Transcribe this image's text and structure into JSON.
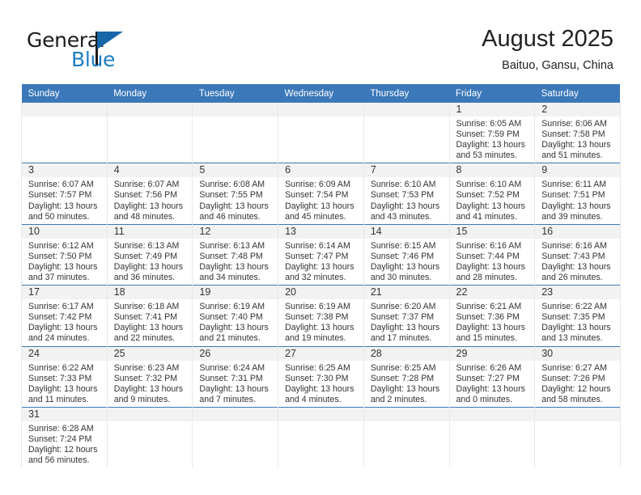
{
  "brand": {
    "name_part1": "General",
    "name_part2": "Blue"
  },
  "header": {
    "title": "August 2025",
    "location": "Baituo, Gansu, China"
  },
  "colors": {
    "header_blue": "#3b78b9",
    "brand_blue": "#1d7ec4",
    "daynum_band": "#f2f2f2",
    "text": "#333333"
  },
  "weekday_headers": [
    "Sunday",
    "Monday",
    "Tuesday",
    "Wednesday",
    "Thursday",
    "Friday",
    "Saturday"
  ],
  "weeks": [
    [
      {
        "day": "",
        "sunrise": "",
        "sunset": "",
        "daylight1": "",
        "daylight2": ""
      },
      {
        "day": "",
        "sunrise": "",
        "sunset": "",
        "daylight1": "",
        "daylight2": ""
      },
      {
        "day": "",
        "sunrise": "",
        "sunset": "",
        "daylight1": "",
        "daylight2": ""
      },
      {
        "day": "",
        "sunrise": "",
        "sunset": "",
        "daylight1": "",
        "daylight2": ""
      },
      {
        "day": "",
        "sunrise": "",
        "sunset": "",
        "daylight1": "",
        "daylight2": ""
      },
      {
        "day": "1",
        "sunrise": "Sunrise: 6:05 AM",
        "sunset": "Sunset: 7:59 PM",
        "daylight1": "Daylight: 13 hours",
        "daylight2": "and 53 minutes."
      },
      {
        "day": "2",
        "sunrise": "Sunrise: 6:06 AM",
        "sunset": "Sunset: 7:58 PM",
        "daylight1": "Daylight: 13 hours",
        "daylight2": "and 51 minutes."
      }
    ],
    [
      {
        "day": "3",
        "sunrise": "Sunrise: 6:07 AM",
        "sunset": "Sunset: 7:57 PM",
        "daylight1": "Daylight: 13 hours",
        "daylight2": "and 50 minutes."
      },
      {
        "day": "4",
        "sunrise": "Sunrise: 6:07 AM",
        "sunset": "Sunset: 7:56 PM",
        "daylight1": "Daylight: 13 hours",
        "daylight2": "and 48 minutes."
      },
      {
        "day": "5",
        "sunrise": "Sunrise: 6:08 AM",
        "sunset": "Sunset: 7:55 PM",
        "daylight1": "Daylight: 13 hours",
        "daylight2": "and 46 minutes."
      },
      {
        "day": "6",
        "sunrise": "Sunrise: 6:09 AM",
        "sunset": "Sunset: 7:54 PM",
        "daylight1": "Daylight: 13 hours",
        "daylight2": "and 45 minutes."
      },
      {
        "day": "7",
        "sunrise": "Sunrise: 6:10 AM",
        "sunset": "Sunset: 7:53 PM",
        "daylight1": "Daylight: 13 hours",
        "daylight2": "and 43 minutes."
      },
      {
        "day": "8",
        "sunrise": "Sunrise: 6:10 AM",
        "sunset": "Sunset: 7:52 PM",
        "daylight1": "Daylight: 13 hours",
        "daylight2": "and 41 minutes."
      },
      {
        "day": "9",
        "sunrise": "Sunrise: 6:11 AM",
        "sunset": "Sunset: 7:51 PM",
        "daylight1": "Daylight: 13 hours",
        "daylight2": "and 39 minutes."
      }
    ],
    [
      {
        "day": "10",
        "sunrise": "Sunrise: 6:12 AM",
        "sunset": "Sunset: 7:50 PM",
        "daylight1": "Daylight: 13 hours",
        "daylight2": "and 37 minutes."
      },
      {
        "day": "11",
        "sunrise": "Sunrise: 6:13 AM",
        "sunset": "Sunset: 7:49 PM",
        "daylight1": "Daylight: 13 hours",
        "daylight2": "and 36 minutes."
      },
      {
        "day": "12",
        "sunrise": "Sunrise: 6:13 AM",
        "sunset": "Sunset: 7:48 PM",
        "daylight1": "Daylight: 13 hours",
        "daylight2": "and 34 minutes."
      },
      {
        "day": "13",
        "sunrise": "Sunrise: 6:14 AM",
        "sunset": "Sunset: 7:47 PM",
        "daylight1": "Daylight: 13 hours",
        "daylight2": "and 32 minutes."
      },
      {
        "day": "14",
        "sunrise": "Sunrise: 6:15 AM",
        "sunset": "Sunset: 7:46 PM",
        "daylight1": "Daylight: 13 hours",
        "daylight2": "and 30 minutes."
      },
      {
        "day": "15",
        "sunrise": "Sunrise: 6:16 AM",
        "sunset": "Sunset: 7:44 PM",
        "daylight1": "Daylight: 13 hours",
        "daylight2": "and 28 minutes."
      },
      {
        "day": "16",
        "sunrise": "Sunrise: 6:16 AM",
        "sunset": "Sunset: 7:43 PM",
        "daylight1": "Daylight: 13 hours",
        "daylight2": "and 26 minutes."
      }
    ],
    [
      {
        "day": "17",
        "sunrise": "Sunrise: 6:17 AM",
        "sunset": "Sunset: 7:42 PM",
        "daylight1": "Daylight: 13 hours",
        "daylight2": "and 24 minutes."
      },
      {
        "day": "18",
        "sunrise": "Sunrise: 6:18 AM",
        "sunset": "Sunset: 7:41 PM",
        "daylight1": "Daylight: 13 hours",
        "daylight2": "and 22 minutes."
      },
      {
        "day": "19",
        "sunrise": "Sunrise: 6:19 AM",
        "sunset": "Sunset: 7:40 PM",
        "daylight1": "Daylight: 13 hours",
        "daylight2": "and 21 minutes."
      },
      {
        "day": "20",
        "sunrise": "Sunrise: 6:19 AM",
        "sunset": "Sunset: 7:38 PM",
        "daylight1": "Daylight: 13 hours",
        "daylight2": "and 19 minutes."
      },
      {
        "day": "21",
        "sunrise": "Sunrise: 6:20 AM",
        "sunset": "Sunset: 7:37 PM",
        "daylight1": "Daylight: 13 hours",
        "daylight2": "and 17 minutes."
      },
      {
        "day": "22",
        "sunrise": "Sunrise: 6:21 AM",
        "sunset": "Sunset: 7:36 PM",
        "daylight1": "Daylight: 13 hours",
        "daylight2": "and 15 minutes."
      },
      {
        "day": "23",
        "sunrise": "Sunrise: 6:22 AM",
        "sunset": "Sunset: 7:35 PM",
        "daylight1": "Daylight: 13 hours",
        "daylight2": "and 13 minutes."
      }
    ],
    [
      {
        "day": "24",
        "sunrise": "Sunrise: 6:22 AM",
        "sunset": "Sunset: 7:33 PM",
        "daylight1": "Daylight: 13 hours",
        "daylight2": "and 11 minutes."
      },
      {
        "day": "25",
        "sunrise": "Sunrise: 6:23 AM",
        "sunset": "Sunset: 7:32 PM",
        "daylight1": "Daylight: 13 hours",
        "daylight2": "and 9 minutes."
      },
      {
        "day": "26",
        "sunrise": "Sunrise: 6:24 AM",
        "sunset": "Sunset: 7:31 PM",
        "daylight1": "Daylight: 13 hours",
        "daylight2": "and 7 minutes."
      },
      {
        "day": "27",
        "sunrise": "Sunrise: 6:25 AM",
        "sunset": "Sunset: 7:30 PM",
        "daylight1": "Daylight: 13 hours",
        "daylight2": "and 4 minutes."
      },
      {
        "day": "28",
        "sunrise": "Sunrise: 6:25 AM",
        "sunset": "Sunset: 7:28 PM",
        "daylight1": "Daylight: 13 hours",
        "daylight2": "and 2 minutes."
      },
      {
        "day": "29",
        "sunrise": "Sunrise: 6:26 AM",
        "sunset": "Sunset: 7:27 PM",
        "daylight1": "Daylight: 13 hours",
        "daylight2": "and 0 minutes."
      },
      {
        "day": "30",
        "sunrise": "Sunrise: 6:27 AM",
        "sunset": "Sunset: 7:26 PM",
        "daylight1": "Daylight: 12 hours",
        "daylight2": "and 58 minutes."
      }
    ],
    [
      {
        "day": "31",
        "sunrise": "Sunrise: 6:28 AM",
        "sunset": "Sunset: 7:24 PM",
        "daylight1": "Daylight: 12 hours",
        "daylight2": "and 56 minutes."
      },
      {
        "day": "",
        "sunrise": "",
        "sunset": "",
        "daylight1": "",
        "daylight2": ""
      },
      {
        "day": "",
        "sunrise": "",
        "sunset": "",
        "daylight1": "",
        "daylight2": ""
      },
      {
        "day": "",
        "sunrise": "",
        "sunset": "",
        "daylight1": "",
        "daylight2": ""
      },
      {
        "day": "",
        "sunrise": "",
        "sunset": "",
        "daylight1": "",
        "daylight2": ""
      },
      {
        "day": "",
        "sunrise": "",
        "sunset": "",
        "daylight1": "",
        "daylight2": ""
      },
      {
        "day": "",
        "sunrise": "",
        "sunset": "",
        "daylight1": "",
        "daylight2": ""
      }
    ]
  ]
}
